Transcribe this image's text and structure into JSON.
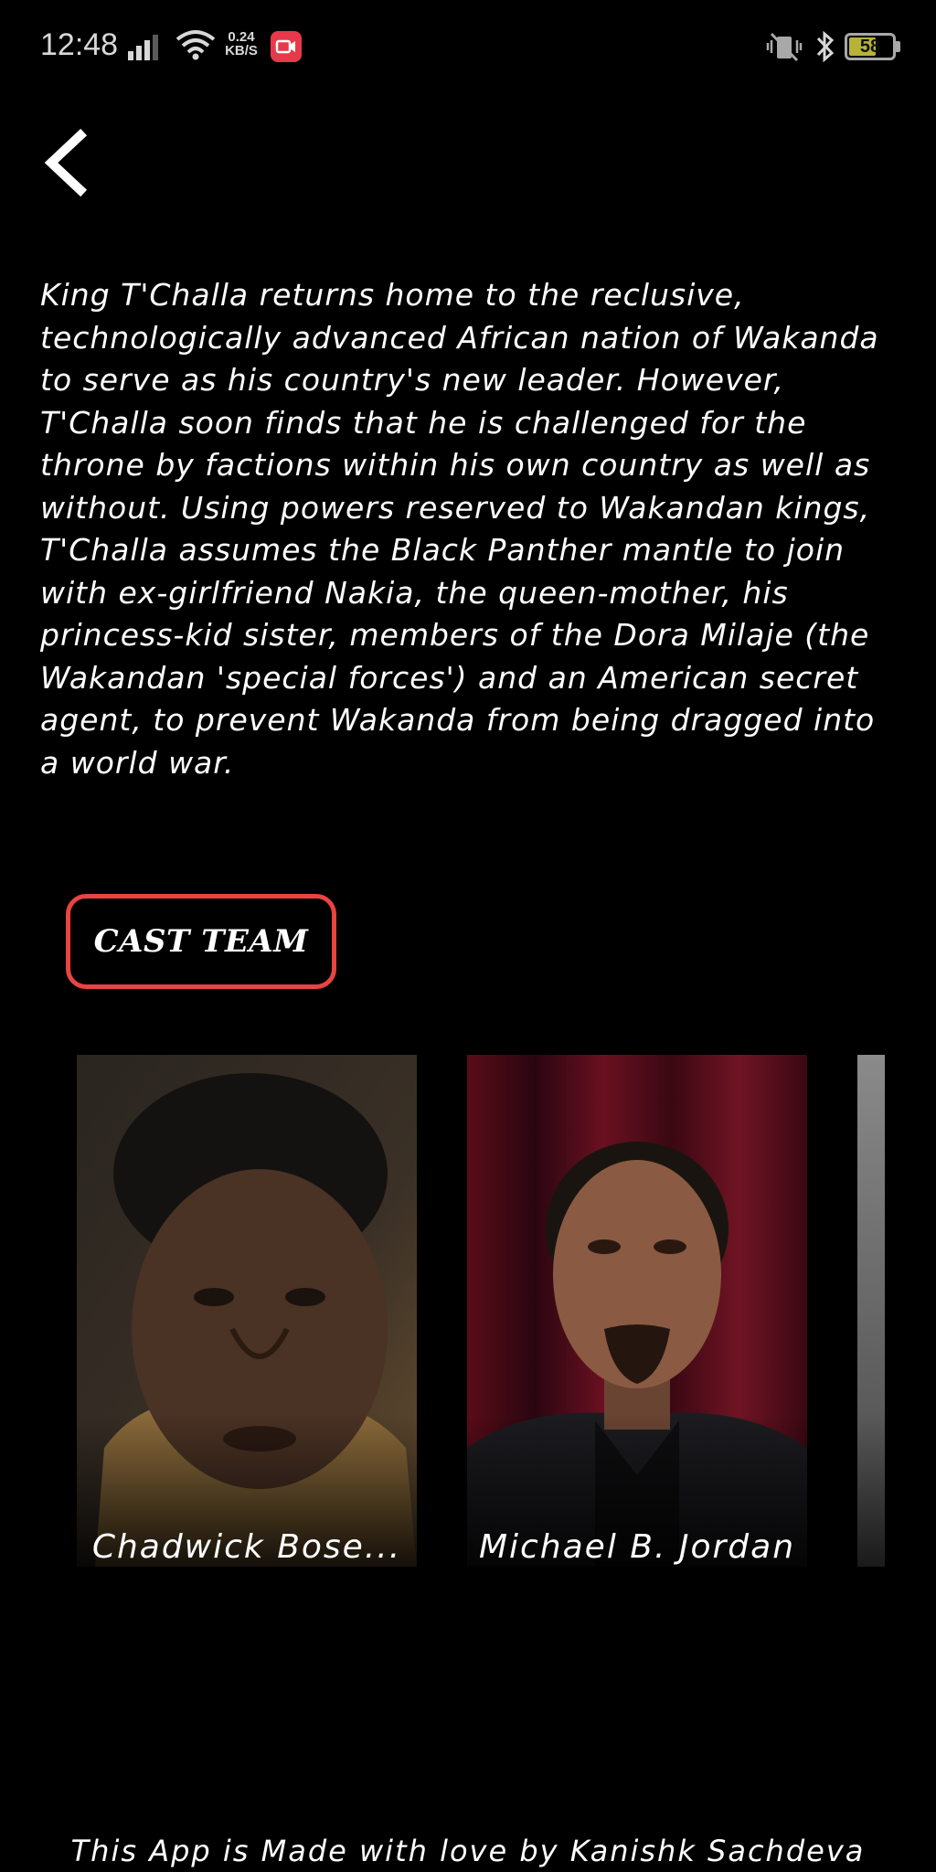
{
  "status_bar": {
    "time": "12:48",
    "net_speed_value": "0.24",
    "net_speed_unit": "KB/S",
    "battery_level": "58",
    "icons": [
      "signal-icon",
      "wifi-icon",
      "screen-record-icon",
      "vibrate-mute-icon",
      "bluetooth-icon",
      "battery-icon"
    ]
  },
  "header": {
    "back_icon": "chevron-left-icon"
  },
  "movie": {
    "description": "King T'Challa returns home to the reclusive, technologically advanced African nation of Wakanda to serve as his country's new leader. However, T'Challa soon finds that he is challenged for the throne by factions within his own country as well as without. Using powers reserved to Wakandan kings, T'Challa assumes the Black Panther mantle to join with ex-girlfriend Nakia, the queen-mother, his princess-kid sister, members of the Dora Milaje (the Wakandan 'special forces') and an American secret agent, to prevent Wakanda from being dragged into a world war."
  },
  "cast_section": {
    "button_label": "CAST TEAM",
    "members": [
      {
        "name": "Chadwick Bose..."
      },
      {
        "name": "Michael B. Jordan"
      }
    ]
  },
  "footer": {
    "text": "This App is Made with love by Kanishk Sachdeva"
  },
  "colors": {
    "background": "#000000",
    "accent_border": "#e84440",
    "text": "#ffffff",
    "record_badge": "#e8394a",
    "battery_fill": "#b7b338"
  }
}
